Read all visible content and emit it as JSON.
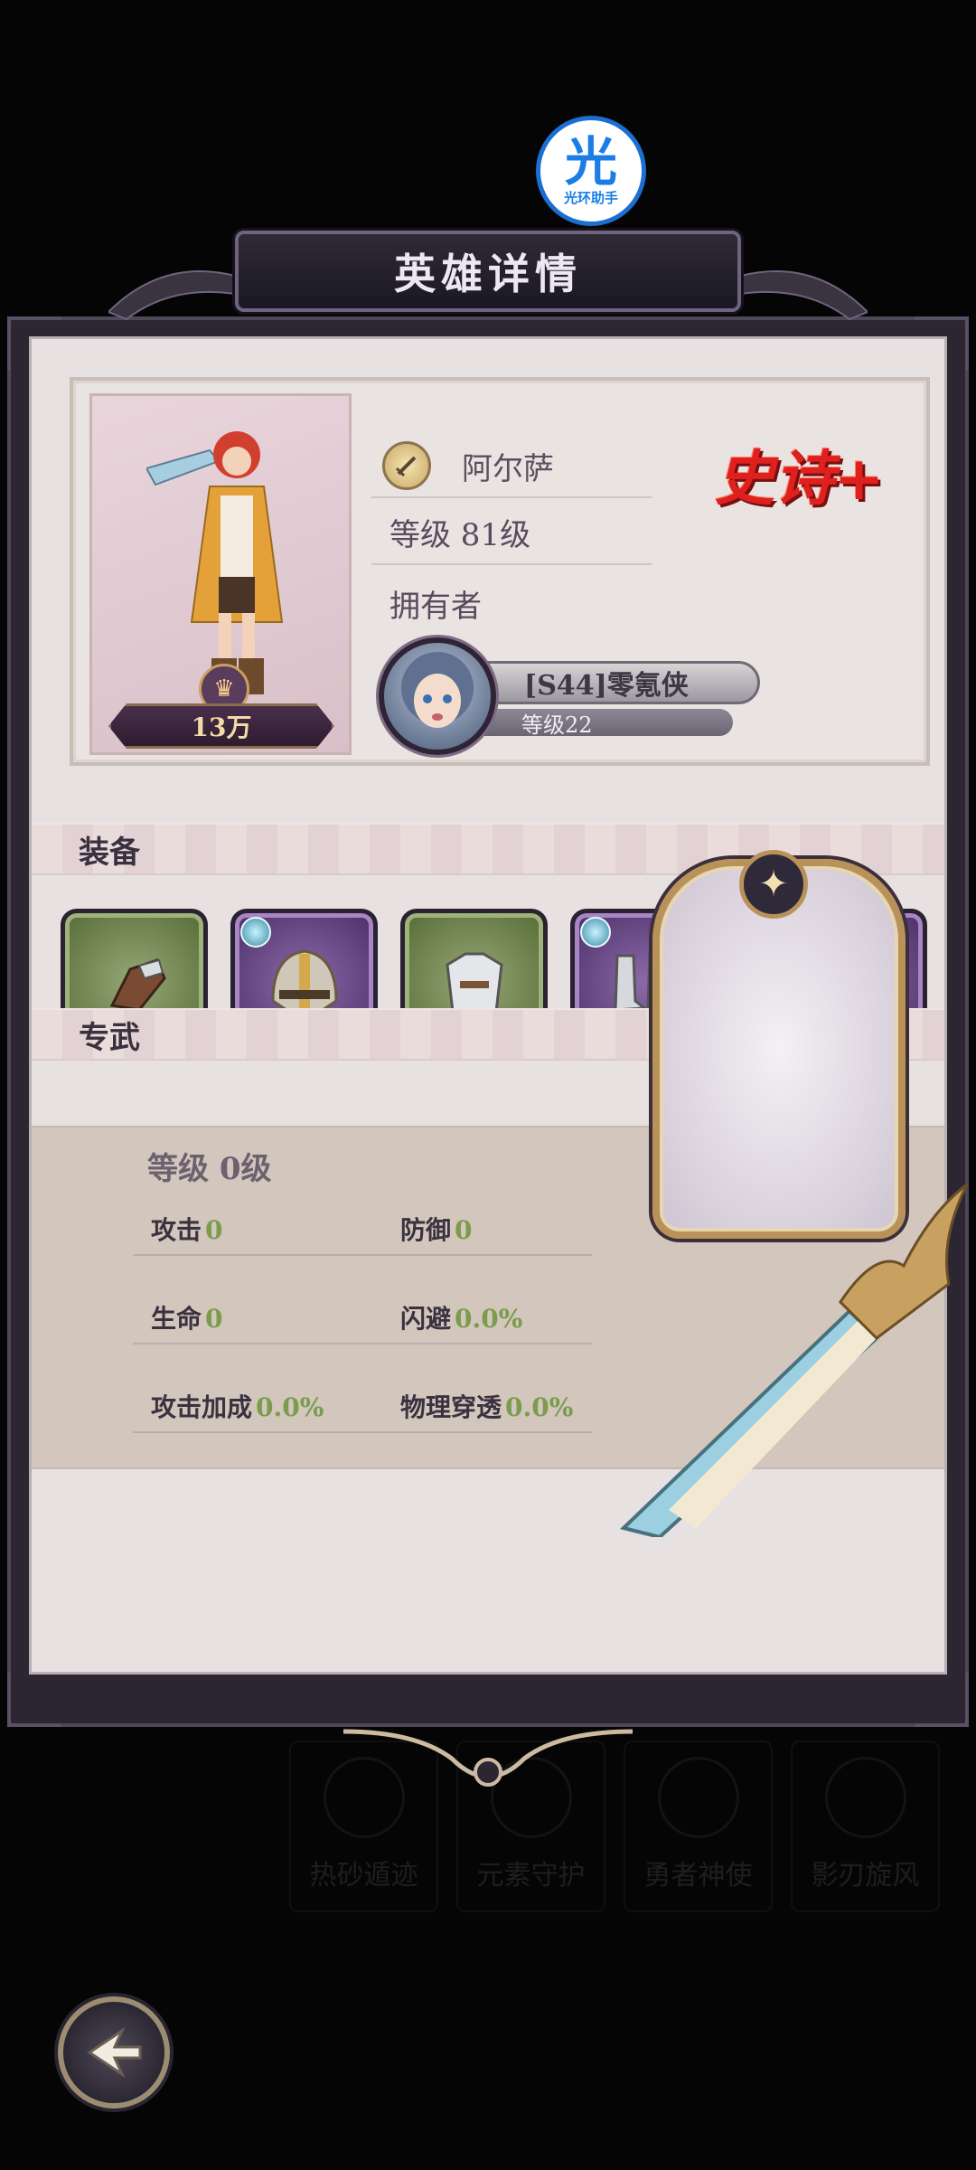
{
  "badge": {
    "glyph": "光",
    "label": "光环助手"
  },
  "header": {
    "title": "英雄详情"
  },
  "hero": {
    "name": "阿尔萨",
    "level": "等级 81级",
    "rarity": "史诗+",
    "power": "13万",
    "owner_label": "拥有者",
    "owner_name": "[S44]零氪侠",
    "owner_level": "等级22"
  },
  "equipment": {
    "section_title": "装备",
    "slots": [
      {
        "icon": "gauntlet-icon",
        "rarity_color": "#566b36",
        "has_gem": false
      },
      {
        "icon": "helmet-icon",
        "rarity_color": "#4b2f68",
        "has_gem": true
      },
      {
        "icon": "chest-armor-icon",
        "rarity_color": "#566b36",
        "has_gem": false
      },
      {
        "icon": "boots-icon",
        "rarity_color": "#4b2f68",
        "has_gem": true
      },
      {
        "icon": "red-crystal-icon",
        "rarity_color": "#4b2f68",
        "has_gem": false
      }
    ]
  },
  "exclusive_weapon": {
    "section_title": "专武",
    "level": "等级 0级",
    "stats": [
      {
        "label": "攻击",
        "value": "0"
      },
      {
        "label": "防御",
        "value": "0"
      },
      {
        "label": "生命",
        "value": "0"
      },
      {
        "label": "闪避",
        "value": "0.0%"
      },
      {
        "label": "攻击加成",
        "value": "0.0%"
      },
      {
        "label": "物理穿透",
        "value": "0.0%"
      }
    ]
  },
  "background_tabs": [
    "热砂遁迹",
    "元素守护",
    "勇者神使",
    "影刃旋风"
  ],
  "colors": {
    "rarity_red": "#e0201e",
    "stat_value_green": "#7b9c4c",
    "frame_gold": "#b9925a"
  }
}
